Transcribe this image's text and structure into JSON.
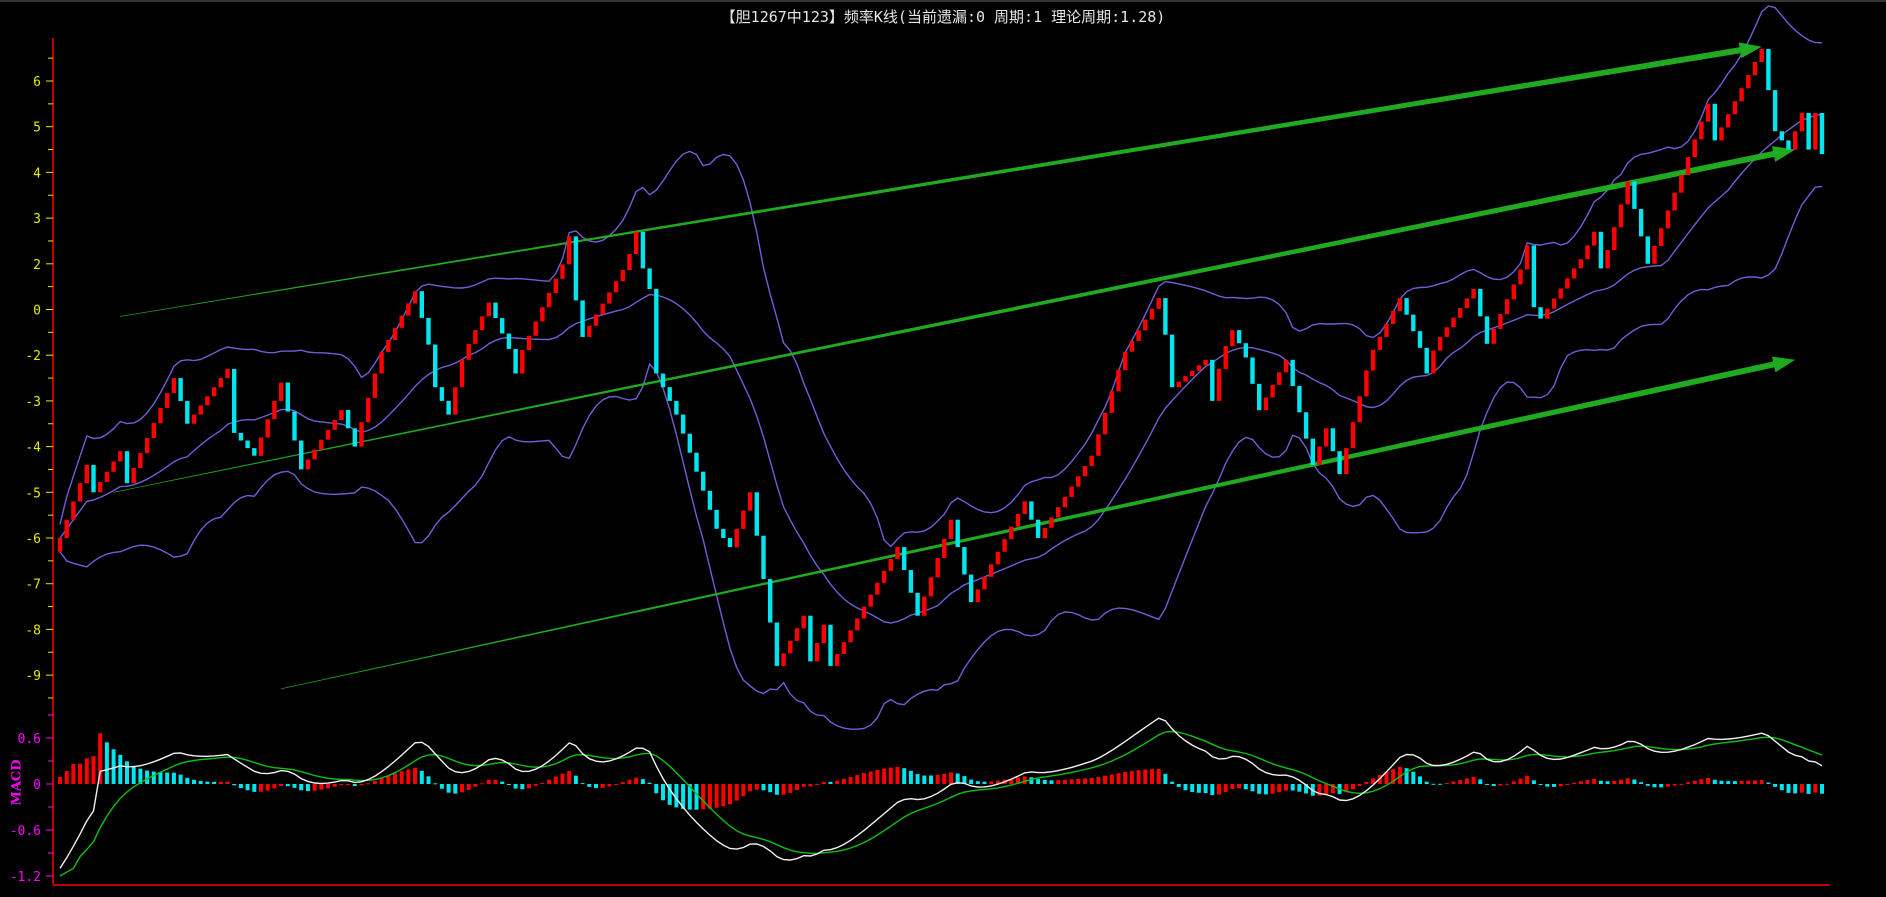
{
  "title": "【胆1267中123】频率K线(当前遗漏:0 周期:1 理论周期:1.28)",
  "colors": {
    "up": "#ff0000",
    "down": "#00e5ee",
    "band": "#6f5fd6",
    "trend": "#22b322",
    "axis": "#c00000",
    "main_label": "#e8e800",
    "macd_label": "#ff00ff",
    "dif": "#f0f0f0",
    "dea": "#10c010"
  },
  "chart_data": [
    {
      "type": "candlestick",
      "name": "frequency-kline",
      "ytick_labels": [
        "6",
        "5",
        "4",
        "3",
        "2",
        "0",
        "-2",
        "-3",
        "-4",
        "-5",
        "-6",
        "-7",
        "-8",
        "-9"
      ],
      "ytick_values": [
        6,
        5,
        4,
        3,
        2,
        0,
        -2,
        -3,
        -4,
        -5,
        -6,
        -7,
        -8,
        -9
      ],
      "bar_count": 264,
      "waypoints": [
        [
          0,
          -6
        ],
        [
          4,
          -4.4
        ],
        [
          5,
          -5
        ],
        [
          9,
          -4.1
        ],
        [
          10,
          -4.8
        ],
        [
          17,
          -2.5
        ],
        [
          19,
          -3.5
        ],
        [
          25,
          -2.3
        ],
        [
          26,
          -3.7
        ],
        [
          29,
          -4.2
        ],
        [
          33,
          -2.6
        ],
        [
          36,
          -4.5
        ],
        [
          42,
          -3.2
        ],
        [
          44,
          -4
        ],
        [
          53,
          0.8
        ],
        [
          56,
          -2.7
        ],
        [
          58,
          -3.3
        ],
        [
          64,
          0.3
        ],
        [
          68,
          -2.4
        ],
        [
          76,
          2.6
        ],
        [
          77,
          0.4
        ],
        [
          78,
          -1.2
        ],
        [
          86,
          2.7
        ],
        [
          88,
          0.9
        ],
        [
          89,
          -2.4
        ],
        [
          92,
          -3.3
        ],
        [
          98,
          -5.8
        ],
        [
          100,
          -6.2
        ],
        [
          103,
          -5
        ],
        [
          107,
          -8.8
        ],
        [
          111,
          -7.7
        ],
        [
          112,
          -8.7
        ],
        [
          114,
          -7.9
        ],
        [
          115,
          -8.8
        ],
        [
          125,
          -6.2
        ],
        [
          128,
          -7.7
        ],
        [
          133,
          -5.6
        ],
        [
          136,
          -7.4
        ],
        [
          144,
          -5.2
        ],
        [
          146,
          -6
        ],
        [
          154,
          -4.2
        ],
        [
          164,
          0.5
        ],
        [
          166,
          -2.7
        ],
        [
          171,
          -2.1
        ],
        [
          172,
          -3
        ],
        [
          175,
          -0.9
        ],
        [
          179,
          -3.2
        ],
        [
          183,
          -2.1
        ],
        [
          187,
          -4.4
        ],
        [
          189,
          -3.6
        ],
        [
          191,
          -4.6
        ],
        [
          200,
          0.5
        ],
        [
          204,
          -2.4
        ],
        [
          206,
          -1.2
        ],
        [
          211,
          0.9
        ],
        [
          213,
          -1.5
        ],
        [
          219,
          2.4
        ],
        [
          220,
          0.1
        ],
        [
          221,
          -0.4
        ],
        [
          226,
          1.8
        ],
        [
          229,
          2.7
        ],
        [
          230,
          1.8
        ],
        [
          234,
          3.8
        ],
        [
          237,
          2
        ],
        [
          246,
          5.5
        ],
        [
          247,
          4.7
        ],
        [
          254,
          6.7
        ],
        [
          256,
          4.9
        ],
        [
          258,
          4.5
        ],
        [
          260,
          5.3
        ],
        [
          261,
          4.5
        ],
        [
          262,
          5.3
        ],
        [
          263,
          4.4
        ]
      ],
      "overlays": [
        "Bollinger upper",
        "Bollinger middle",
        "Bollinger lower"
      ],
      "trend_arrows": [
        {
          "from": [
            9,
            -0.3
          ],
          "to": [
            254,
            6.75
          ]
        },
        {
          "from": [
            8,
            -5.0
          ],
          "to": [
            259,
            4.5
          ]
        },
        {
          "from": [
            33,
            -9.3
          ],
          "to": [
            259,
            -2.1
          ]
        }
      ]
    },
    {
      "type": "bar+line",
      "name": "MACD",
      "label": "MACD",
      "ytick_labels": [
        "0.6",
        "0",
        "-0.6",
        "-1.2"
      ],
      "ytick_values": [
        0.6,
        0,
        -0.6,
        -1.2
      ],
      "series": [
        "DIF",
        "DEA",
        "MACD histogram"
      ]
    }
  ]
}
